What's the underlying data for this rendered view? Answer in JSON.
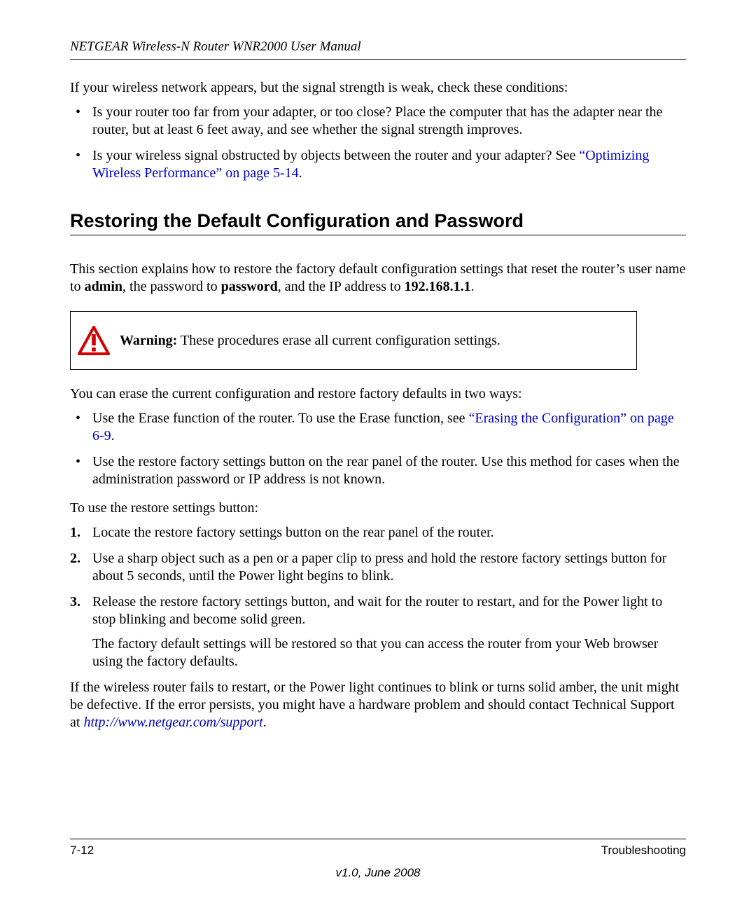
{
  "header": {
    "running_title": "NETGEAR Wireless-N Router WNR2000 User Manual"
  },
  "intro": {
    "lead": "If your wireless network appears, but the signal strength is weak, check these conditions:",
    "bullets": [
      {
        "text": "Is your router too far from your adapter, or too close? Place the computer that has the adapter near the router, but at least 6 feet away, and see whether the signal strength improves."
      },
      {
        "pre": "Is your wireless signal obstructed by objects between the router and your adapter? See ",
        "link": "“Optimizing Wireless Performance” on page 5-14",
        "post": "."
      }
    ]
  },
  "section": {
    "title": "Restoring the Default Configuration and Password",
    "para1_pre": "This section explains how to restore the factory default configuration settings that reset the router’s user name to ",
    "para1_b1": "admin",
    "para1_mid1": ", the password to ",
    "para1_b2": "password",
    "para1_mid2": ", and the IP address to ",
    "para1_b3": "192.168.1.1",
    "para1_post": ".",
    "warning_label": "Warning:",
    "warning_text": " These procedures erase all current configuration settings.",
    "para2": "You can erase the current configuration and restore factory defaults in two ways:",
    "ways": [
      {
        "pre": "Use the Erase function of the router. To use the Erase function, see ",
        "link": "“Erasing the Configuration” on page 6-9",
        "post": "."
      },
      {
        "text": "Use the restore factory settings button on the rear panel of the router. Use this method for cases when the administration password or IP address is not known."
      }
    ],
    "para3": "To use the restore settings button:",
    "steps": [
      {
        "text": "Locate the restore factory settings button on the rear panel of the router."
      },
      {
        "text": "Use a sharp object such as a pen or a paper clip to press and hold the restore factory settings button for about 5 seconds, until the Power light begins to blink."
      },
      {
        "text": "Release the restore factory settings button, and wait for the router to restart, and for the Power light to stop blinking and become solid green.",
        "sub": "The factory default settings will be restored so that you can access the router from your Web browser using the factory defaults."
      }
    ],
    "para4_pre": "If the wireless router fails to restart, or the Power light continues to blink or turns solid amber, the unit might be defective. If the error persists, you might have a hardware problem and should contact Technical Support at ",
    "para4_link": "http://www.netgear.com/support",
    "para4_post": "."
  },
  "footer": {
    "page_num": "7-12",
    "section_name": "Troubleshooting",
    "version": "v1.0, June 2008"
  }
}
